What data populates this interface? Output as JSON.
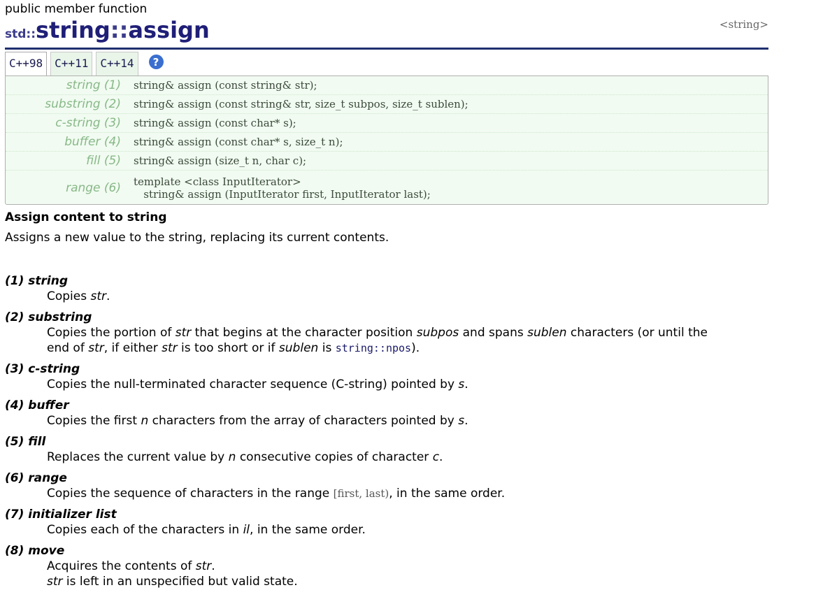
{
  "header": {
    "kind": "public member function",
    "ns": "std::",
    "name": "string",
    "sep": "::",
    "method": "assign",
    "tag": "<string>"
  },
  "tabs": [
    "C++98",
    "C++11",
    "C++14"
  ],
  "help_label": "?",
  "prototypes": [
    {
      "label": "string (1)",
      "code": "string& assign (const string& str);"
    },
    {
      "label": "substring (2)",
      "code": "string& assign (const string& str, size_t subpos, size_t sublen);"
    },
    {
      "label": "c-string (3)",
      "code": "string& assign (const char* s);"
    },
    {
      "label": "buffer (4)",
      "code": "string& assign (const char* s, size_t n);"
    },
    {
      "label": "fill (5)",
      "code": "string& assign (size_t n, char c);"
    },
    {
      "label": "range (6)",
      "code_line1": "template <class InputIterator>",
      "code_line2": "   string& assign (InputIterator first, InputIterator last);"
    }
  ],
  "section_title": "Assign content to string",
  "description": "Assigns a new value to the string, replacing its current contents.",
  "params": [
    {
      "term": "(1) string",
      "def_parts": [
        "Copies ",
        "str",
        "."
      ]
    },
    {
      "term": "(2) substring",
      "def_a": "Copies the portion of ",
      "def_b": "str",
      "def_c": " that begins at the character position ",
      "def_d": "subpos",
      "def_e": " and spans ",
      "def_f": "sublen",
      "def_g": " characters (or until the",
      "def2_a": "end of ",
      "def2_b": "str",
      "def2_c": ", if either ",
      "def2_d": "str",
      "def2_e": " is too short or if ",
      "def2_f": "sublen",
      "def2_g": " is ",
      "def2_link": "string::npos",
      "def2_h": ")."
    },
    {
      "term": "(3) c-string",
      "def_parts": [
        "Copies the null-terminated character sequence (C-string) pointed by ",
        "s",
        "."
      ]
    },
    {
      "term": "(4) buffer",
      "def_a": "Copies the first ",
      "def_b": "n",
      "def_c": " characters from the array of characters pointed by ",
      "def_d": "s",
      "def_e": "."
    },
    {
      "term": "(5) fill",
      "def_a": "Replaces the current value by ",
      "def_b": "n",
      "def_c": " consecutive copies of character ",
      "def_d": "c",
      "def_e": "."
    },
    {
      "term": "(6) range",
      "def_a": "Copies the sequence of characters in the range ",
      "def_range": "[first, last)",
      "def_b": ", in the same order."
    },
    {
      "term": "(7) initializer list",
      "def_a": "Copies each of the characters in ",
      "def_b": "il",
      "def_c": ", in the same order."
    },
    {
      "term": "(8) move",
      "def_a": "Acquires the contents of ",
      "def_b": "str",
      "def_c": ".",
      "def2_a": "str",
      "def2_b": " is left in an unspecified but valid state."
    }
  ]
}
